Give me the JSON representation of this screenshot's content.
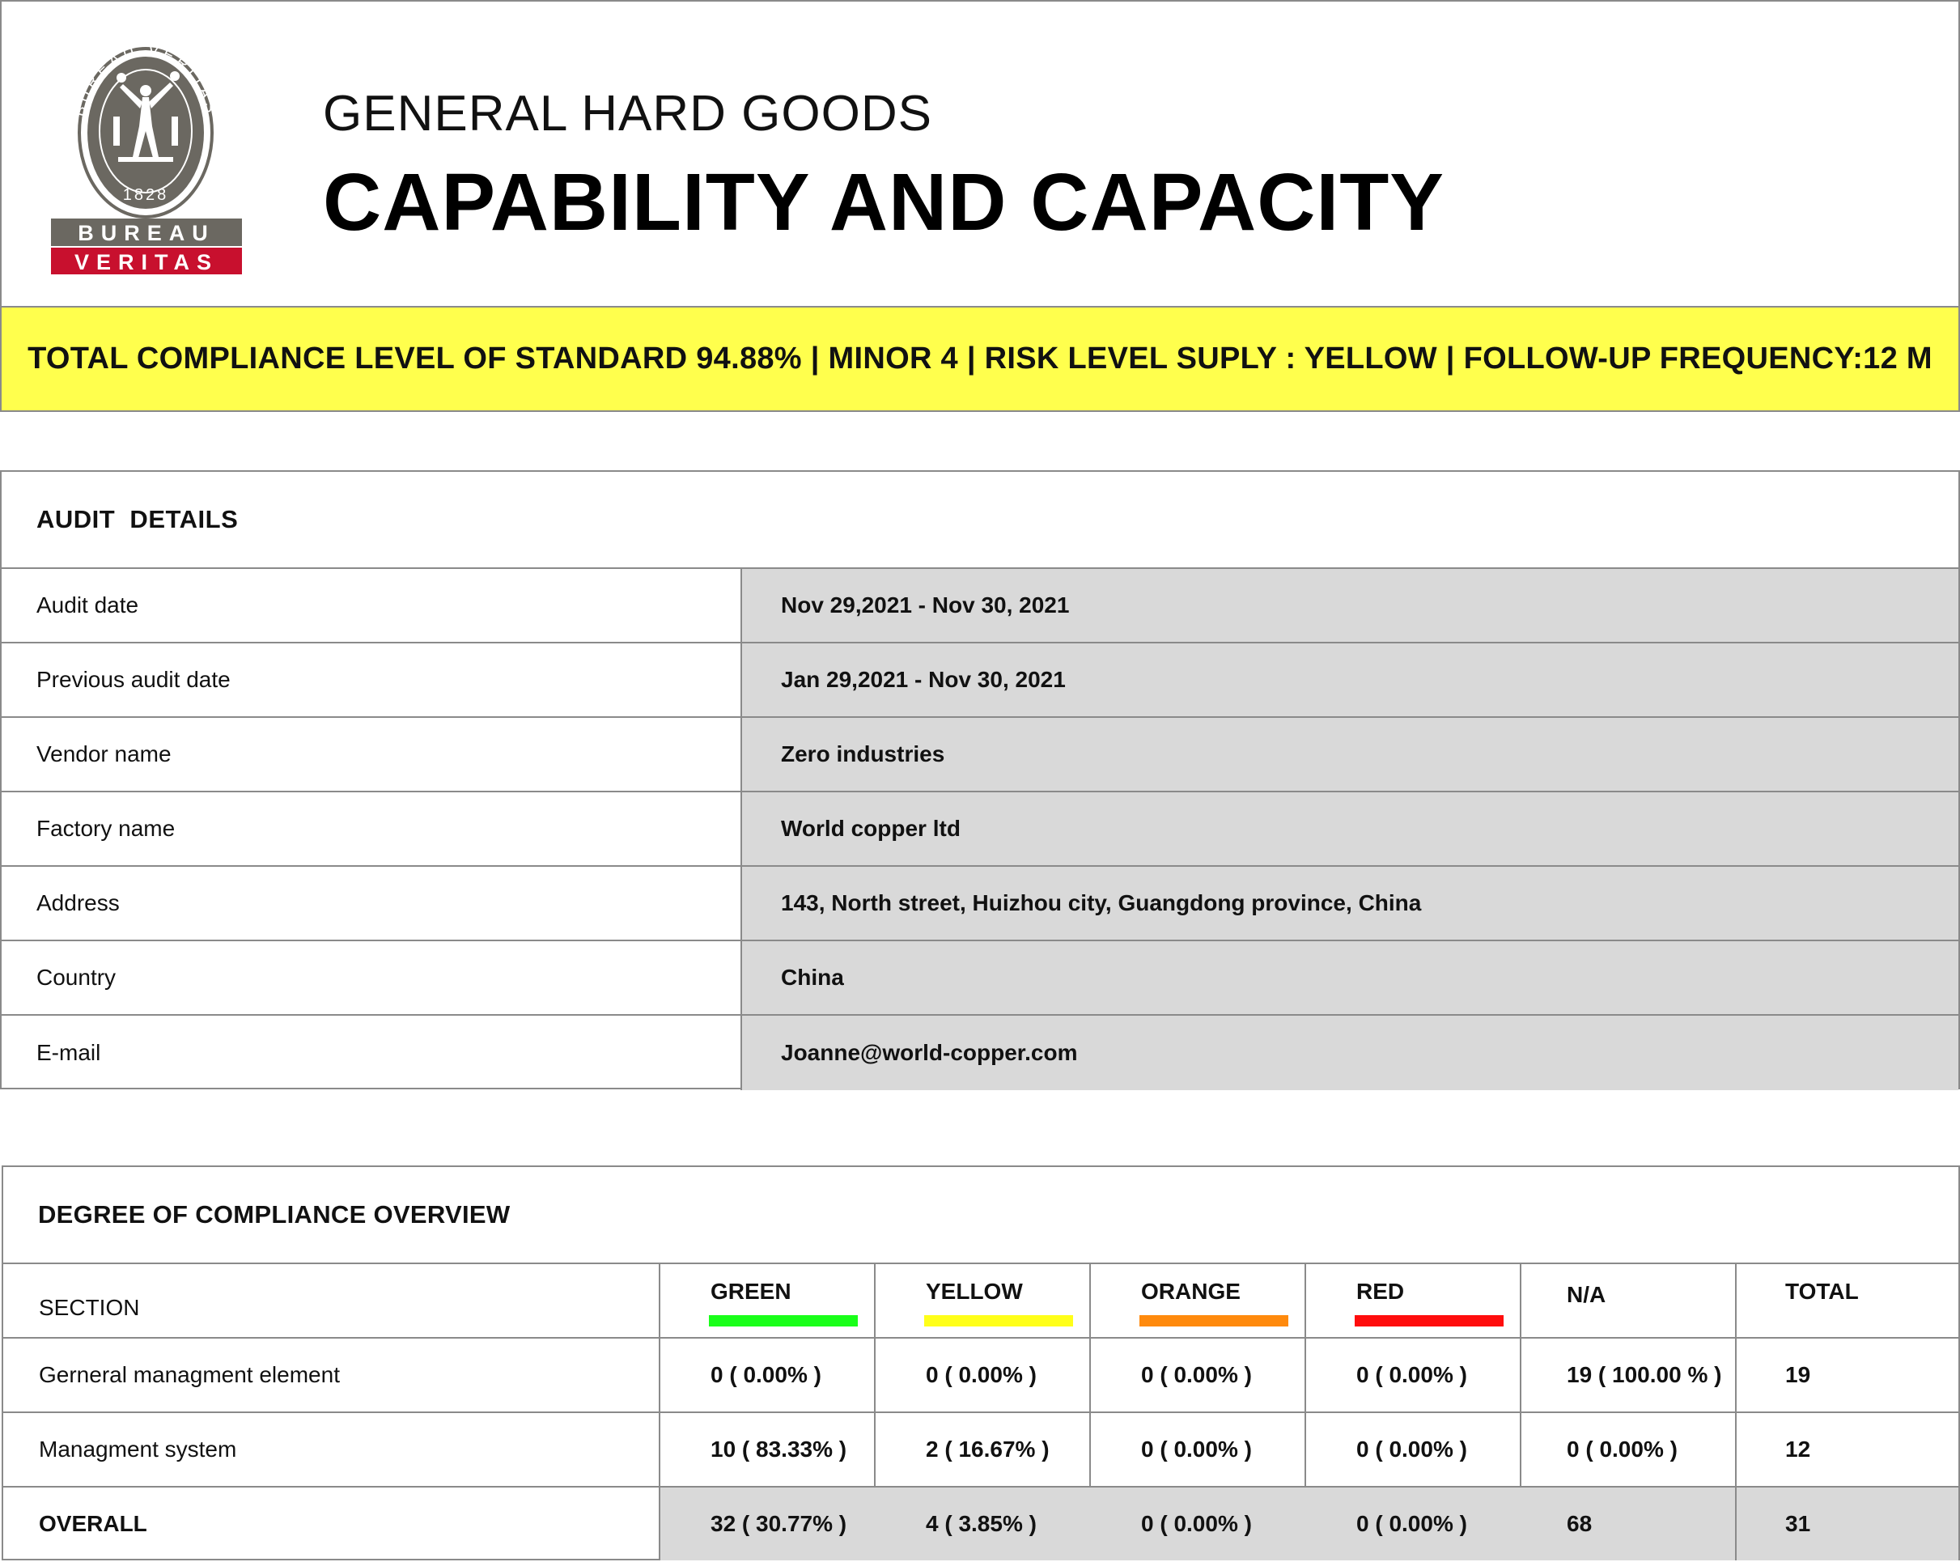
{
  "logo": {
    "text_top": "BUREAU VERITAS",
    "year": "1828",
    "line1": "BUREAU",
    "line2": "VERITAS"
  },
  "header": {
    "subtitle": "GENERAL HARD GOODS",
    "title": "CAPABILITY AND CAPACITY"
  },
  "banner": {
    "text": "TOTAL COMPLIANCE LEVEL OF STANDARD 94.88% | MINOR 4 | RISK LEVEL SUPLY : YELLOW | FOLLOW-UP FREQUENCY:12 M",
    "color": "#ffff4d"
  },
  "audit": {
    "heading": "AUDIT  DETAILS",
    "rows": [
      {
        "label": "Audit date",
        "value": "Nov 29,2021 - Nov 30, 2021"
      },
      {
        "label": "Previous audit date",
        "value": "Jan 29,2021 - Nov 30, 2021"
      },
      {
        "label": "Vendor name",
        "value": "Zero industries"
      },
      {
        "label": "Factory name",
        "value": "World copper ltd"
      },
      {
        "label": "Address",
        "value": "143, North street, Huizhou city, Guangdong province, China"
      },
      {
        "label": "Country",
        "value": "China"
      },
      {
        "label": "E-mail",
        "value": "Joanne@world-copper.com"
      }
    ]
  },
  "compliance": {
    "heading": "DEGREE OF COMPLIANCE OVERVIEW",
    "columns": {
      "section": "SECTION",
      "green": "GREEN",
      "yellow": "YELLOW",
      "orange": "ORANGE",
      "red": "RED",
      "na": "N/A",
      "total": "TOTAL"
    },
    "colors": {
      "green": "#19ff19",
      "yellow": "#ffff19",
      "orange": "#ff8a0d",
      "red": "#ff0d0d"
    },
    "rows": [
      {
        "section": "Gerneral managment element",
        "green": "0 ( 0.00% )",
        "yellow": "0 ( 0.00% )",
        "orange": "0 ( 0.00% )",
        "red": "0 ( 0.00% )",
        "na": "19 ( 100.00 % )",
        "total": "19"
      },
      {
        "section": "Managment system",
        "green": "10 ( 83.33% )",
        "yellow": "2 ( 16.67% )",
        "orange": "0 ( 0.00% )",
        "red": "0 ( 0.00% )",
        "na": "0 ( 0.00% )",
        "total": "12"
      }
    ],
    "overall": {
      "section": "OVERALL",
      "green": "32 ( 30.77% )",
      "yellow": "4 ( 3.85% )",
      "orange": "0 ( 0.00% )",
      "red": "0 ( 0.00% )",
      "na": "68",
      "total": "31"
    }
  }
}
